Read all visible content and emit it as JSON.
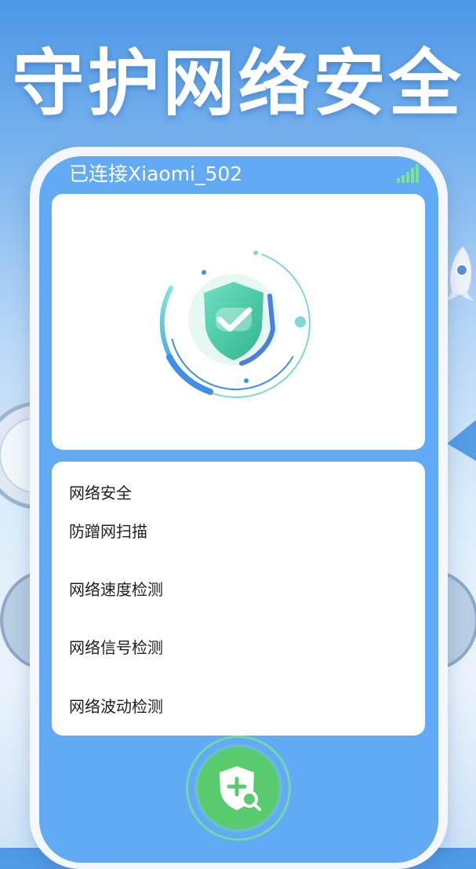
{
  "headline": "守护网络安全",
  "status": {
    "connection_text": "已连接Xiaomi_502",
    "signal_icon": "wifi-signal-icon"
  },
  "hero": {
    "icon": "shield-check-icon"
  },
  "menu": {
    "title": "网络安全",
    "items": [
      {
        "label": "防蹭网扫描"
      },
      {
        "label": "网络速度检测"
      },
      {
        "label": "网络信号检测"
      },
      {
        "label": "网络波动检测"
      }
    ]
  },
  "scan_button": {
    "icon": "shield-plus-search-icon"
  },
  "colors": {
    "screen_blue": "#62aaf3",
    "accent_green": "#58cc6c",
    "shield_teal": "#3cc7a8",
    "ring_blue": "#4aa3e6"
  }
}
